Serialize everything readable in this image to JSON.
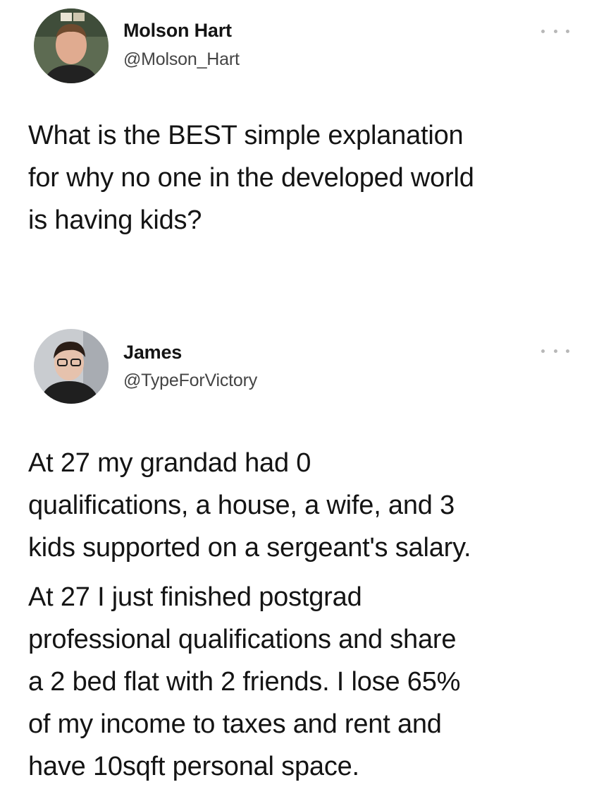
{
  "tweets": [
    {
      "name": "Molson Hart",
      "handle": "@Molson_Hart",
      "more_icon": "more-horizontal-icon",
      "lines": [
        "What is the BEST simple explanation",
        "for why no one in the developed world",
        "is having kids?"
      ]
    },
    {
      "name": "James",
      "handle": "@TypeForVictory",
      "more_icon": "more-horizontal-icon",
      "paragraphs": [
        [
          "At 27 my grandad had 0",
          "qualifications, a house, a wife, and 3",
          "kids supported on a sergeant's salary."
        ],
        [
          "At 27 I just finished postgrad",
          "professional qualifications and share",
          "a 2 bed flat with 2 friends. I lose 65%",
          "of my income to taxes and rent and",
          "have 10sqft personal space."
        ]
      ]
    }
  ]
}
